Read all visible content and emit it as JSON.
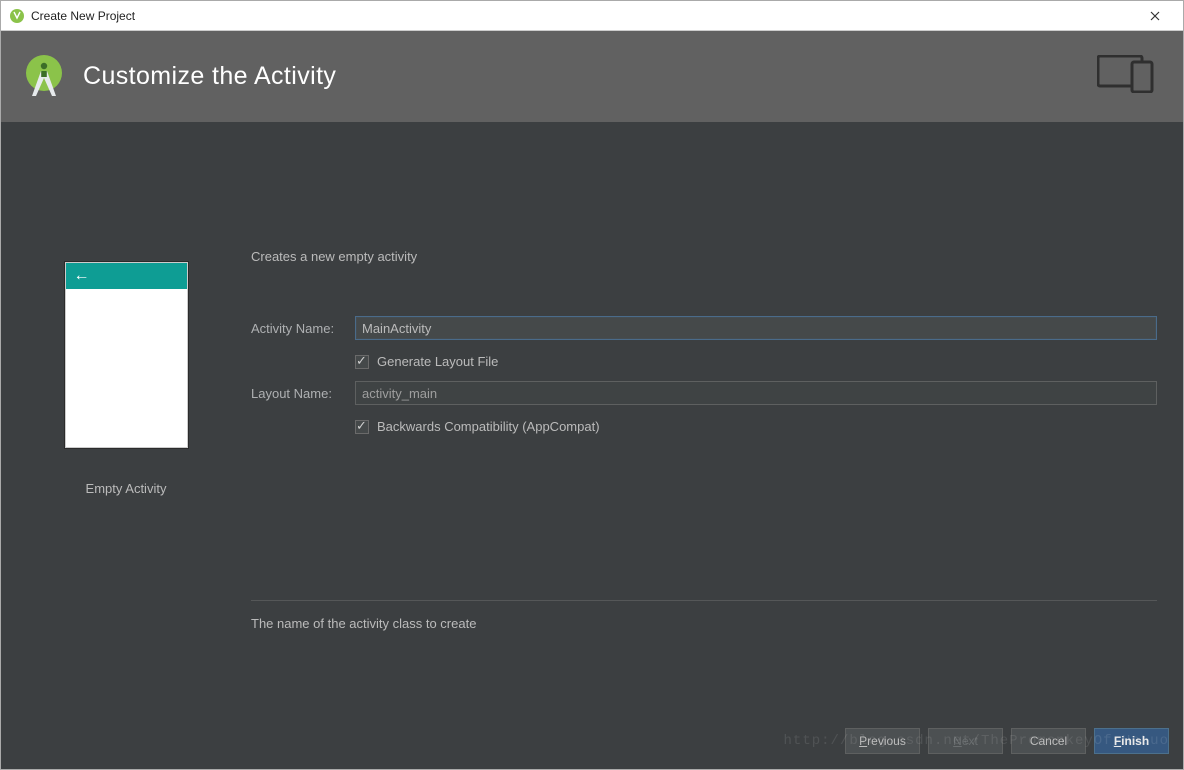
{
  "window": {
    "title": "Create New Project"
  },
  "banner": {
    "title": "Customize the Activity"
  },
  "preview": {
    "caption": "Empty Activity"
  },
  "form": {
    "description": "Creates a new empty activity",
    "activity_name_label": "Activity Name:",
    "activity_name_value": "MainActivity",
    "generate_layout_label": "Generate Layout File",
    "generate_layout_checked": true,
    "layout_name_label": "Layout Name:",
    "layout_name_value": "activity_main",
    "backwards_compat_label": "Backwards Compatibility (AppCompat)",
    "backwards_compat_checked": true,
    "hint": "The name of the activity class to create"
  },
  "footer": {
    "previous": "Previous",
    "next": "Next",
    "cancel": "Cancel",
    "finish": "Finish"
  },
  "watermark": "http://blog.csdn.net/ThePromonkeyOf_HeLuo"
}
